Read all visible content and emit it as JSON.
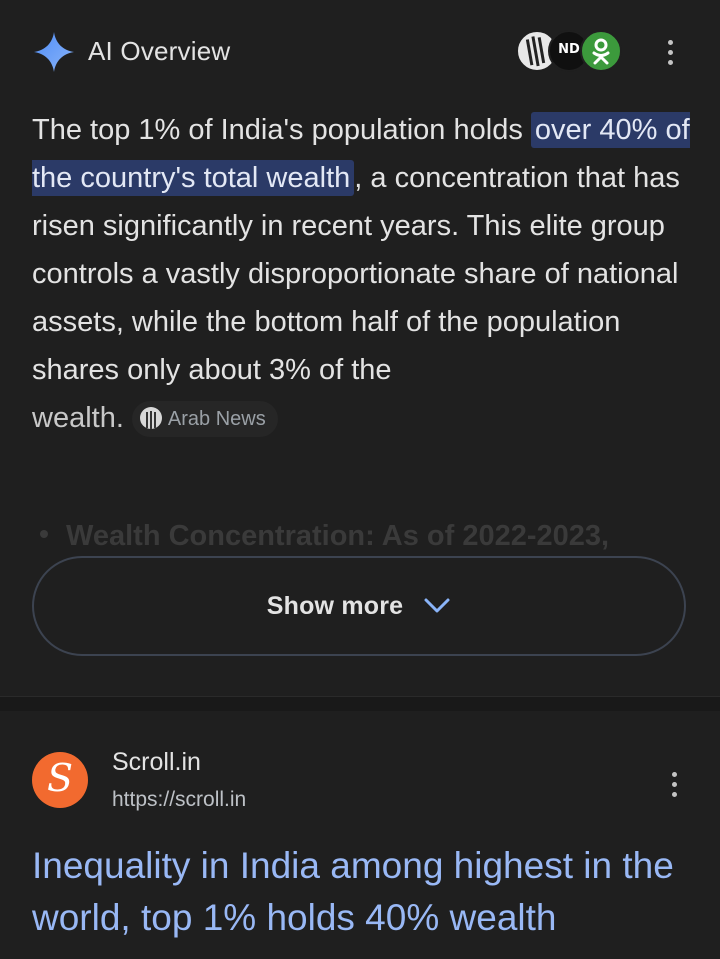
{
  "ai_overview": {
    "title": "AI Overview",
    "paragraph": {
      "before": "The top 1% of India's population holds ",
      "highlight": "over 40% of the country's total wealth",
      "after": ", a concentration that has risen significantly in recent years. This elite group controls a vastly disproportionate share of national assets, while the bottom half of the population shares only about 3% of the",
      "last_word": "wealth.",
      "source_chip": "Arab News"
    },
    "faded_bullet": "Wealth Concentration: As of 2022-2023,",
    "show_more_label": "Show more",
    "source_avatars": [
      "Arab News",
      "ND",
      "Odnoklassniki"
    ]
  },
  "result": {
    "site_name": "Scroll.in",
    "url": "https://scroll.in",
    "logo_letter": "S",
    "title": "Inequality in India among highest in the world, top 1% holds 40% wealth"
  },
  "colors": {
    "background": "#1f1f1f",
    "highlight_bg": "#2b3a67",
    "link_blue": "#99b8f5",
    "logo_orange": "#f26a2f"
  }
}
